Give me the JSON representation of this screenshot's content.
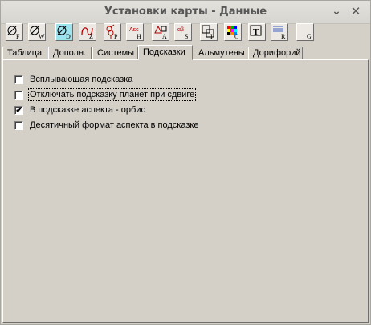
{
  "window": {
    "title": "Установки карты - Данные",
    "minimize_glyph": "⌄",
    "close_glyph": "✕"
  },
  "toolbar": {
    "buttons": [
      {
        "icon": "sun-F-icon",
        "letter": "F"
      },
      {
        "icon": "sun-W-icon",
        "letter": "W"
      },
      {
        "icon": "sun-D-icon",
        "letter": "D",
        "active": true
      },
      {
        "icon": "aspect-Z-icon",
        "letter": "Z"
      },
      {
        "icon": "mars-venus-P-icon",
        "letter": "P"
      },
      {
        "icon": "asc-H-icon",
        "letter": "H",
        "top": "Asc"
      },
      {
        "icon": "shapes-A-icon",
        "letter": "A"
      },
      {
        "icon": "alpha-beta-S-icon",
        "letter": "S",
        "top": "αβ"
      },
      {
        "icon": "frame-I-icon",
        "letter": "I"
      },
      {
        "icon": "color-C-icon",
        "letter": "C"
      },
      {
        "icon": "font-T-icon",
        "letter": "T"
      },
      {
        "icon": "lines-R-icon",
        "letter": "R"
      },
      {
        "icon": "blank-G-icon",
        "letter": "G"
      }
    ]
  },
  "tabs": [
    {
      "label": "Таблица"
    },
    {
      "label": "Дополн."
    },
    {
      "label": "Системы"
    },
    {
      "label": "Подсказки",
      "selected": true
    },
    {
      "label": "Альмутены"
    },
    {
      "label": "Дорифорий"
    }
  ],
  "options": [
    {
      "label": "Всплывающая подсказка",
      "checked": false
    },
    {
      "label": "Отключать подсказку планет при сдвиге",
      "checked": false,
      "focused": true
    },
    {
      "label": "В подсказке аспекта - орбис",
      "checked": true
    },
    {
      "label": "Десятичный формат аспекта в подсказке",
      "checked": false
    }
  ],
  "colors": {
    "active_tool": "#9ee4ee",
    "face": "#d4d0c8"
  }
}
